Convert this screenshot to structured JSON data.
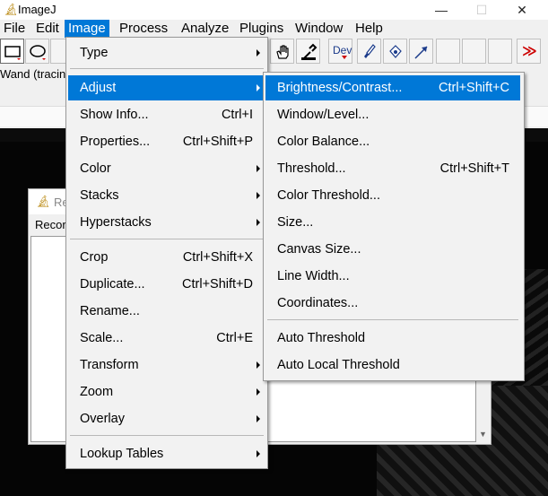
{
  "window": {
    "title": "ImageJ",
    "minimize": "—",
    "maximize": "☐",
    "close": "✕"
  },
  "menubar": [
    "File",
    "Edit",
    "Image",
    "Process",
    "Analyze",
    "Plugins",
    "Window",
    "Help"
  ],
  "toolbar": {
    "dev_label": "Dev",
    "more_label": "≫",
    "icons": [
      "rectangle-tool-icon",
      "oval-tool-icon",
      "hand-tool-icon",
      "dropper-tool-icon",
      "brush-icon",
      "flood-fill-icon",
      "arrow-icon"
    ]
  },
  "status_text": "Wand (tracing",
  "results_window": {
    "title": "Re",
    "header": "Recor"
  },
  "image_menu": {
    "items": [
      {
        "label": "Type",
        "shortcut": "",
        "submenu": true
      },
      {
        "label": "Adjust",
        "shortcut": "",
        "submenu": true,
        "highlighted": true
      },
      {
        "label": "Show Info...",
        "shortcut": "Ctrl+I",
        "submenu": false
      },
      {
        "label": "Properties...",
        "shortcut": "Ctrl+Shift+P",
        "submenu": false
      },
      {
        "label": "Color",
        "shortcut": "",
        "submenu": true
      },
      {
        "label": "Stacks",
        "shortcut": "",
        "submenu": true
      },
      {
        "label": "Hyperstacks",
        "shortcut": "",
        "submenu": true
      },
      {
        "label": "Crop",
        "shortcut": "Ctrl+Shift+X",
        "submenu": false
      },
      {
        "label": "Duplicate...",
        "shortcut": "Ctrl+Shift+D",
        "submenu": false
      },
      {
        "label": "Rename...",
        "shortcut": "",
        "submenu": false
      },
      {
        "label": "Scale...",
        "shortcut": "Ctrl+E",
        "submenu": false
      },
      {
        "label": "Transform",
        "shortcut": "",
        "submenu": true
      },
      {
        "label": "Zoom",
        "shortcut": "",
        "submenu": true
      },
      {
        "label": "Overlay",
        "shortcut": "",
        "submenu": true
      },
      {
        "label": "Lookup Tables",
        "shortcut": "",
        "submenu": true
      }
    ]
  },
  "adjust_menu": {
    "items": [
      {
        "label": "Brightness/Contrast...",
        "shortcut": "Ctrl+Shift+C",
        "highlighted": true
      },
      {
        "label": "Window/Level...",
        "shortcut": ""
      },
      {
        "label": "Color Balance...",
        "shortcut": ""
      },
      {
        "label": "Threshold...",
        "shortcut": "Ctrl+Shift+T"
      },
      {
        "label": "Color Threshold...",
        "shortcut": ""
      },
      {
        "label": "Size...",
        "shortcut": ""
      },
      {
        "label": "Canvas Size...",
        "shortcut": ""
      },
      {
        "label": "Line Width...",
        "shortcut": ""
      },
      {
        "label": "Coordinates...",
        "shortcut": ""
      },
      {
        "label": "Auto Threshold",
        "shortcut": ""
      },
      {
        "label": "Auto Local Threshold",
        "shortcut": ""
      }
    ]
  },
  "colors": {
    "highlight": "#0078d7",
    "menu_bg": "#f2f2f2"
  }
}
